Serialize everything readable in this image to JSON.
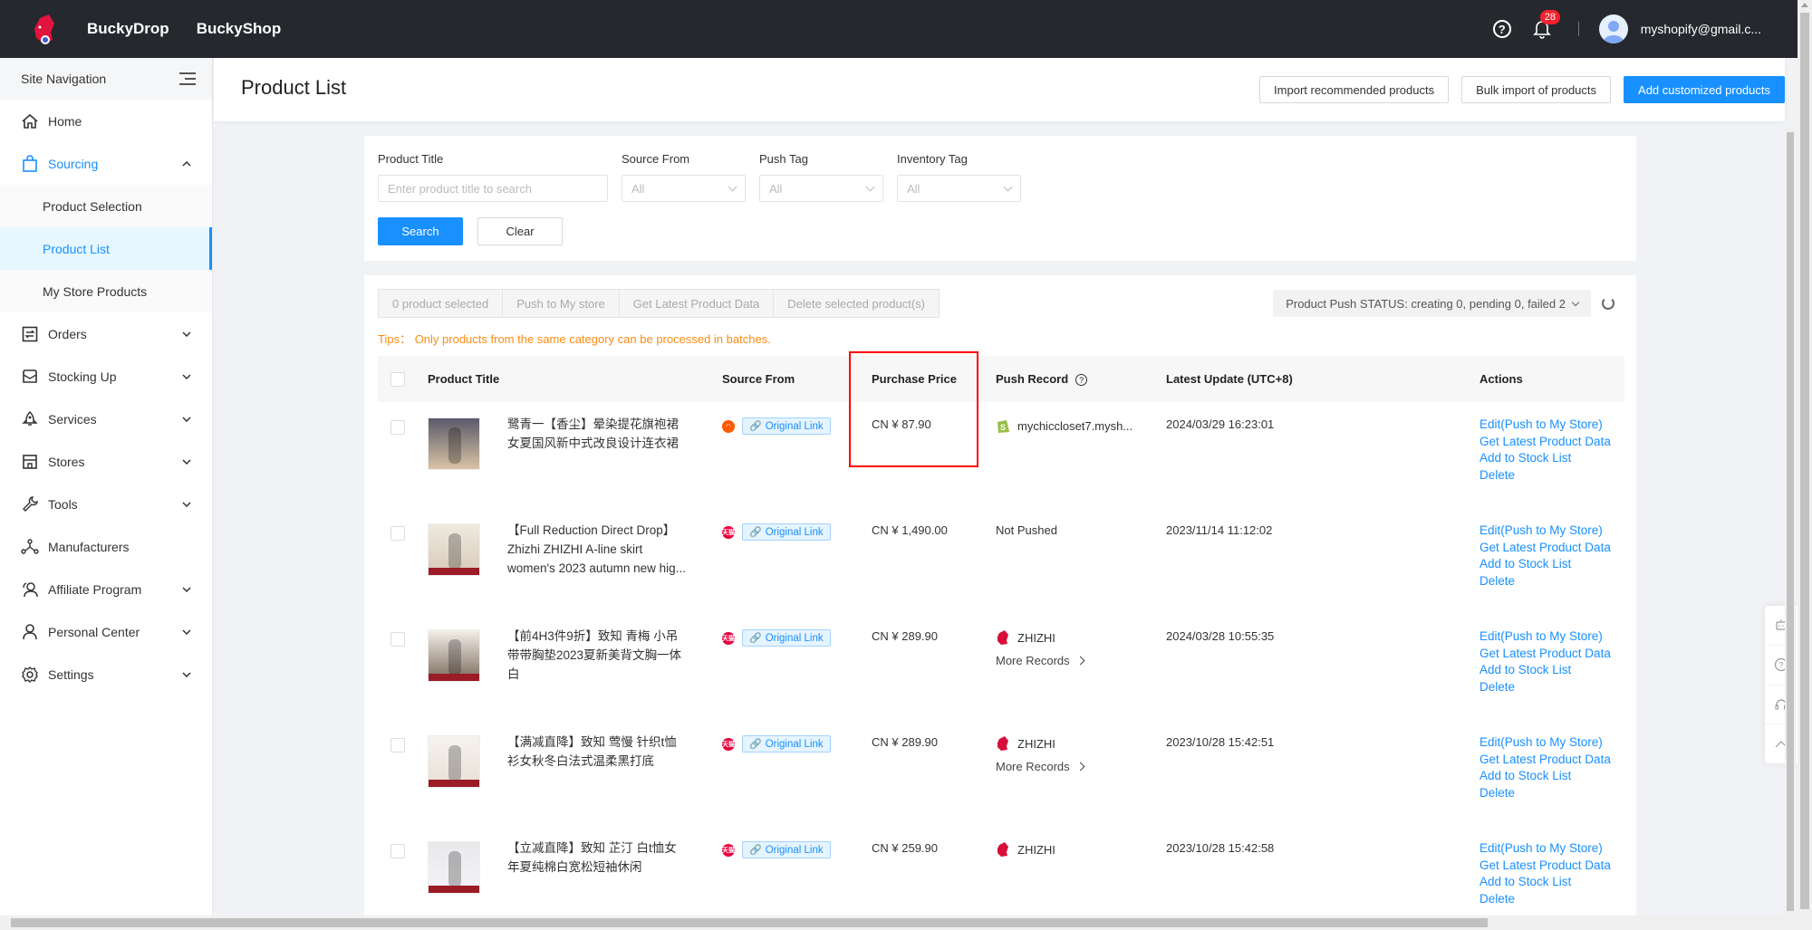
{
  "header": {
    "brands": [
      "BuckyDrop",
      "BuckyShop"
    ],
    "notification_count": "28",
    "user_email": "myshopify@gmail.c..."
  },
  "sidebar": {
    "title": "Site Navigation",
    "items": [
      {
        "label": "Home",
        "icon": "home-icon",
        "expandable": false
      },
      {
        "label": "Sourcing",
        "icon": "shopping-bag-icon",
        "expandable": true,
        "expanded": true,
        "children": [
          {
            "label": "Product Selection",
            "active": false
          },
          {
            "label": "Product List",
            "active": true
          },
          {
            "label": "My Store Products",
            "active": false
          }
        ]
      },
      {
        "label": "Orders",
        "icon": "orders-icon",
        "expandable": true
      },
      {
        "label": "Stocking Up",
        "icon": "inbox-icon",
        "expandable": true
      },
      {
        "label": "Services",
        "icon": "rocket-icon",
        "expandable": true
      },
      {
        "label": "Stores",
        "icon": "store-icon",
        "expandable": true
      },
      {
        "label": "Tools",
        "icon": "wrench-icon",
        "expandable": true
      },
      {
        "label": "Manufacturers",
        "icon": "network-icon",
        "expandable": false
      },
      {
        "label": "Affiliate Program",
        "icon": "users-icon",
        "expandable": true
      },
      {
        "label": "Personal Center",
        "icon": "user-icon",
        "expandable": true
      },
      {
        "label": "Settings",
        "icon": "gear-icon",
        "expandable": true
      }
    ]
  },
  "page": {
    "title": "Product List",
    "buttons": {
      "import_recommended": "Import recommended products",
      "bulk_import": "Bulk import of products",
      "add_customized": "Add customized products"
    }
  },
  "filters": {
    "product_title": {
      "label": "Product Title",
      "placeholder": "Enter product title to search",
      "value": ""
    },
    "source_from": {
      "label": "Source From",
      "value": "All"
    },
    "push_tag": {
      "label": "Push Tag",
      "value": "All"
    },
    "inventory_tag": {
      "label": "Inventory Tag",
      "value": "All"
    },
    "search_label": "Search",
    "clear_label": "Clear"
  },
  "batch": {
    "selected": "0 product selected",
    "push": "Push to My store",
    "get_latest": "Get Latest Product Data",
    "delete": "Delete selected product(s)",
    "tips": "Tips： Only products from the same category can be processed in batches.",
    "push_status": "Product Push STATUS: creating 0, pending 0, failed 2"
  },
  "table": {
    "columns": [
      "Product Title",
      "Source From",
      "Purchase Price",
      "Push Record",
      "Latest Update (UTC+8)",
      "Actions"
    ],
    "original_link_label": "Original Link",
    "more_records_label": "More Records",
    "actions": [
      "Edit(Push to My Store)",
      "Get Latest Product Data",
      "Add to Stock List",
      "Delete"
    ],
    "rows": [
      {
        "title": "鹭青一【香尘】晕染提花旗袍裙女夏国风新中式改良设计连衣裙",
        "source": "1688",
        "price": "CN ¥ 87.90",
        "push_record": "mychiccloset7.mysh...",
        "store_type": "shopify",
        "more_records": false,
        "updated": "2024/03/29 16:23:01"
      },
      {
        "title": "【Full Reduction Direct Drop】Zhizhi ZHIZHI A-line skirt women's 2023 autumn new hig...",
        "source": "tmall",
        "price": "CN ¥ 1,490.00",
        "push_record": "Not Pushed",
        "store_type": "none",
        "more_records": false,
        "updated": "2023/11/14 11:12:02"
      },
      {
        "title": "【前4H3件9折】致知 青梅 小吊带带胸垫2023夏新美背文胸一体白",
        "source": "tmall",
        "price": "CN ¥ 289.90",
        "push_record": "ZHIZHI",
        "store_type": "buckyshop",
        "more_records": true,
        "updated": "2024/03/28 10:55:35"
      },
      {
        "title": "【满减直降】致知 莺慢 针织t恤衫女秋冬白法式温柔黑打底",
        "source": "tmall",
        "price": "CN ¥ 289.90",
        "push_record": "ZHIZHI",
        "store_type": "buckyshop",
        "more_records": true,
        "updated": "2023/10/28 15:42:51"
      },
      {
        "title": "【立减直降】致知 芷汀 白t恤女年夏纯棉白宽松短袖休闲",
        "source": "tmall",
        "price": "CN ¥ 259.90",
        "push_record": "ZHIZHI",
        "store_type": "buckyshop",
        "more_records": false,
        "updated": "2023/10/28 15:42:58"
      }
    ]
  },
  "colors": {
    "primary": "#1890ff",
    "header_bg": "#25282d",
    "tips": "#fa8c16",
    "highlight": "#ff0000"
  }
}
